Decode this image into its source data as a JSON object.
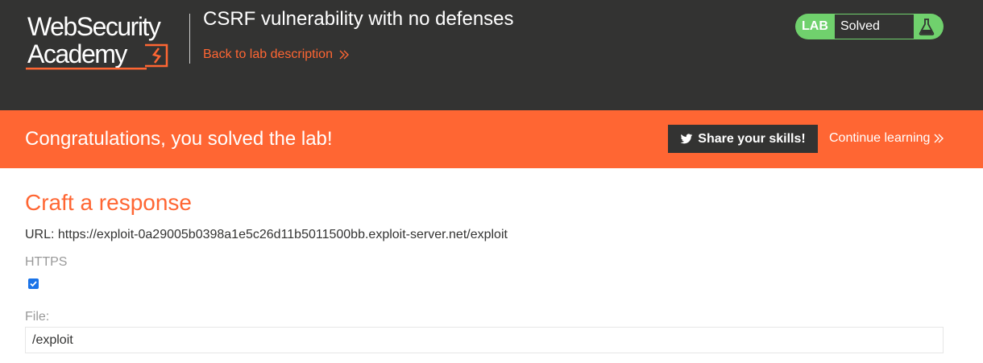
{
  "header": {
    "logo": {
      "line1": "WebSecurity",
      "line2": "Academy"
    },
    "lab_title": "CSRF vulnerability with no defenses",
    "back_link": "Back to lab description",
    "lab_status": {
      "label": "LAB",
      "status": "Solved"
    }
  },
  "banner": {
    "message": "Congratulations, you solved the lab!",
    "share_button": "Share your skills!",
    "continue_link": "Continue learning"
  },
  "form": {
    "title": "Craft a response",
    "url_line": "URL: https://exploit-0a29005b0398a1e5c26d11b5011500bb.exploit-server.net/exploit",
    "https_label": "HTTPS",
    "https_checked": true,
    "file_label": "File:",
    "file_value": "/exploit"
  },
  "colors": {
    "header_bg": "#333332",
    "accent": "#ff6633",
    "lab_solved_green": "#70d16d",
    "checkbox_blue": "#1a73e8"
  },
  "icons": [
    "websecurity-academy-logo",
    "double-chevron-right-icon",
    "flask-icon",
    "twitter-bird-icon"
  ]
}
